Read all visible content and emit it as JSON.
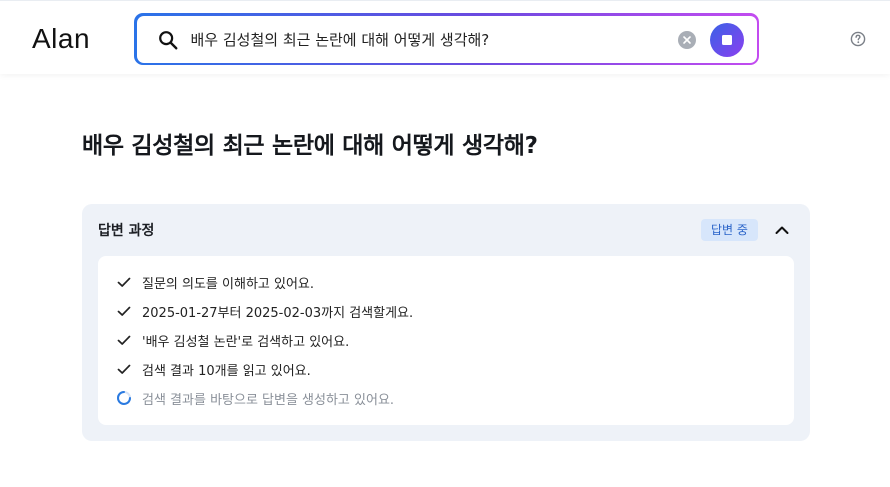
{
  "header": {
    "logo": "Alan",
    "search": {
      "value": "배우 김성철의 최근 논란에 대해 어떻게 생각해?",
      "icon": "search-icon"
    },
    "clear_icon": "close-icon",
    "stop_icon": "stop-icon",
    "help_icon": "help-icon"
  },
  "question": "배우 김성철의 최근 논란에 대해 어떻게 생각해?",
  "process": {
    "title": "답변 과정",
    "status": "답변 중",
    "steps": [
      {
        "text": "질문의 의도를 이해하고 있어요.",
        "state": "done"
      },
      {
        "text": "2025-01-27부터 2025-02-03까지 검색할게요.",
        "state": "done"
      },
      {
        "text": "'배우 김성철 논란'로 검색하고 있어요.",
        "state": "done"
      },
      {
        "text": "검색 결과 10개를 읽고 있어요.",
        "state": "done"
      },
      {
        "text": "검색 결과를 바탕으로 답변을 생성하고 있어요.",
        "state": "in-progress"
      }
    ]
  },
  "colors": {
    "accent_start": "#2a73e8",
    "accent_end": "#c34bf0",
    "badge_bg": "#d7e6fb",
    "badge_text": "#2a64c9",
    "panel_bg": "#eef2f8"
  }
}
